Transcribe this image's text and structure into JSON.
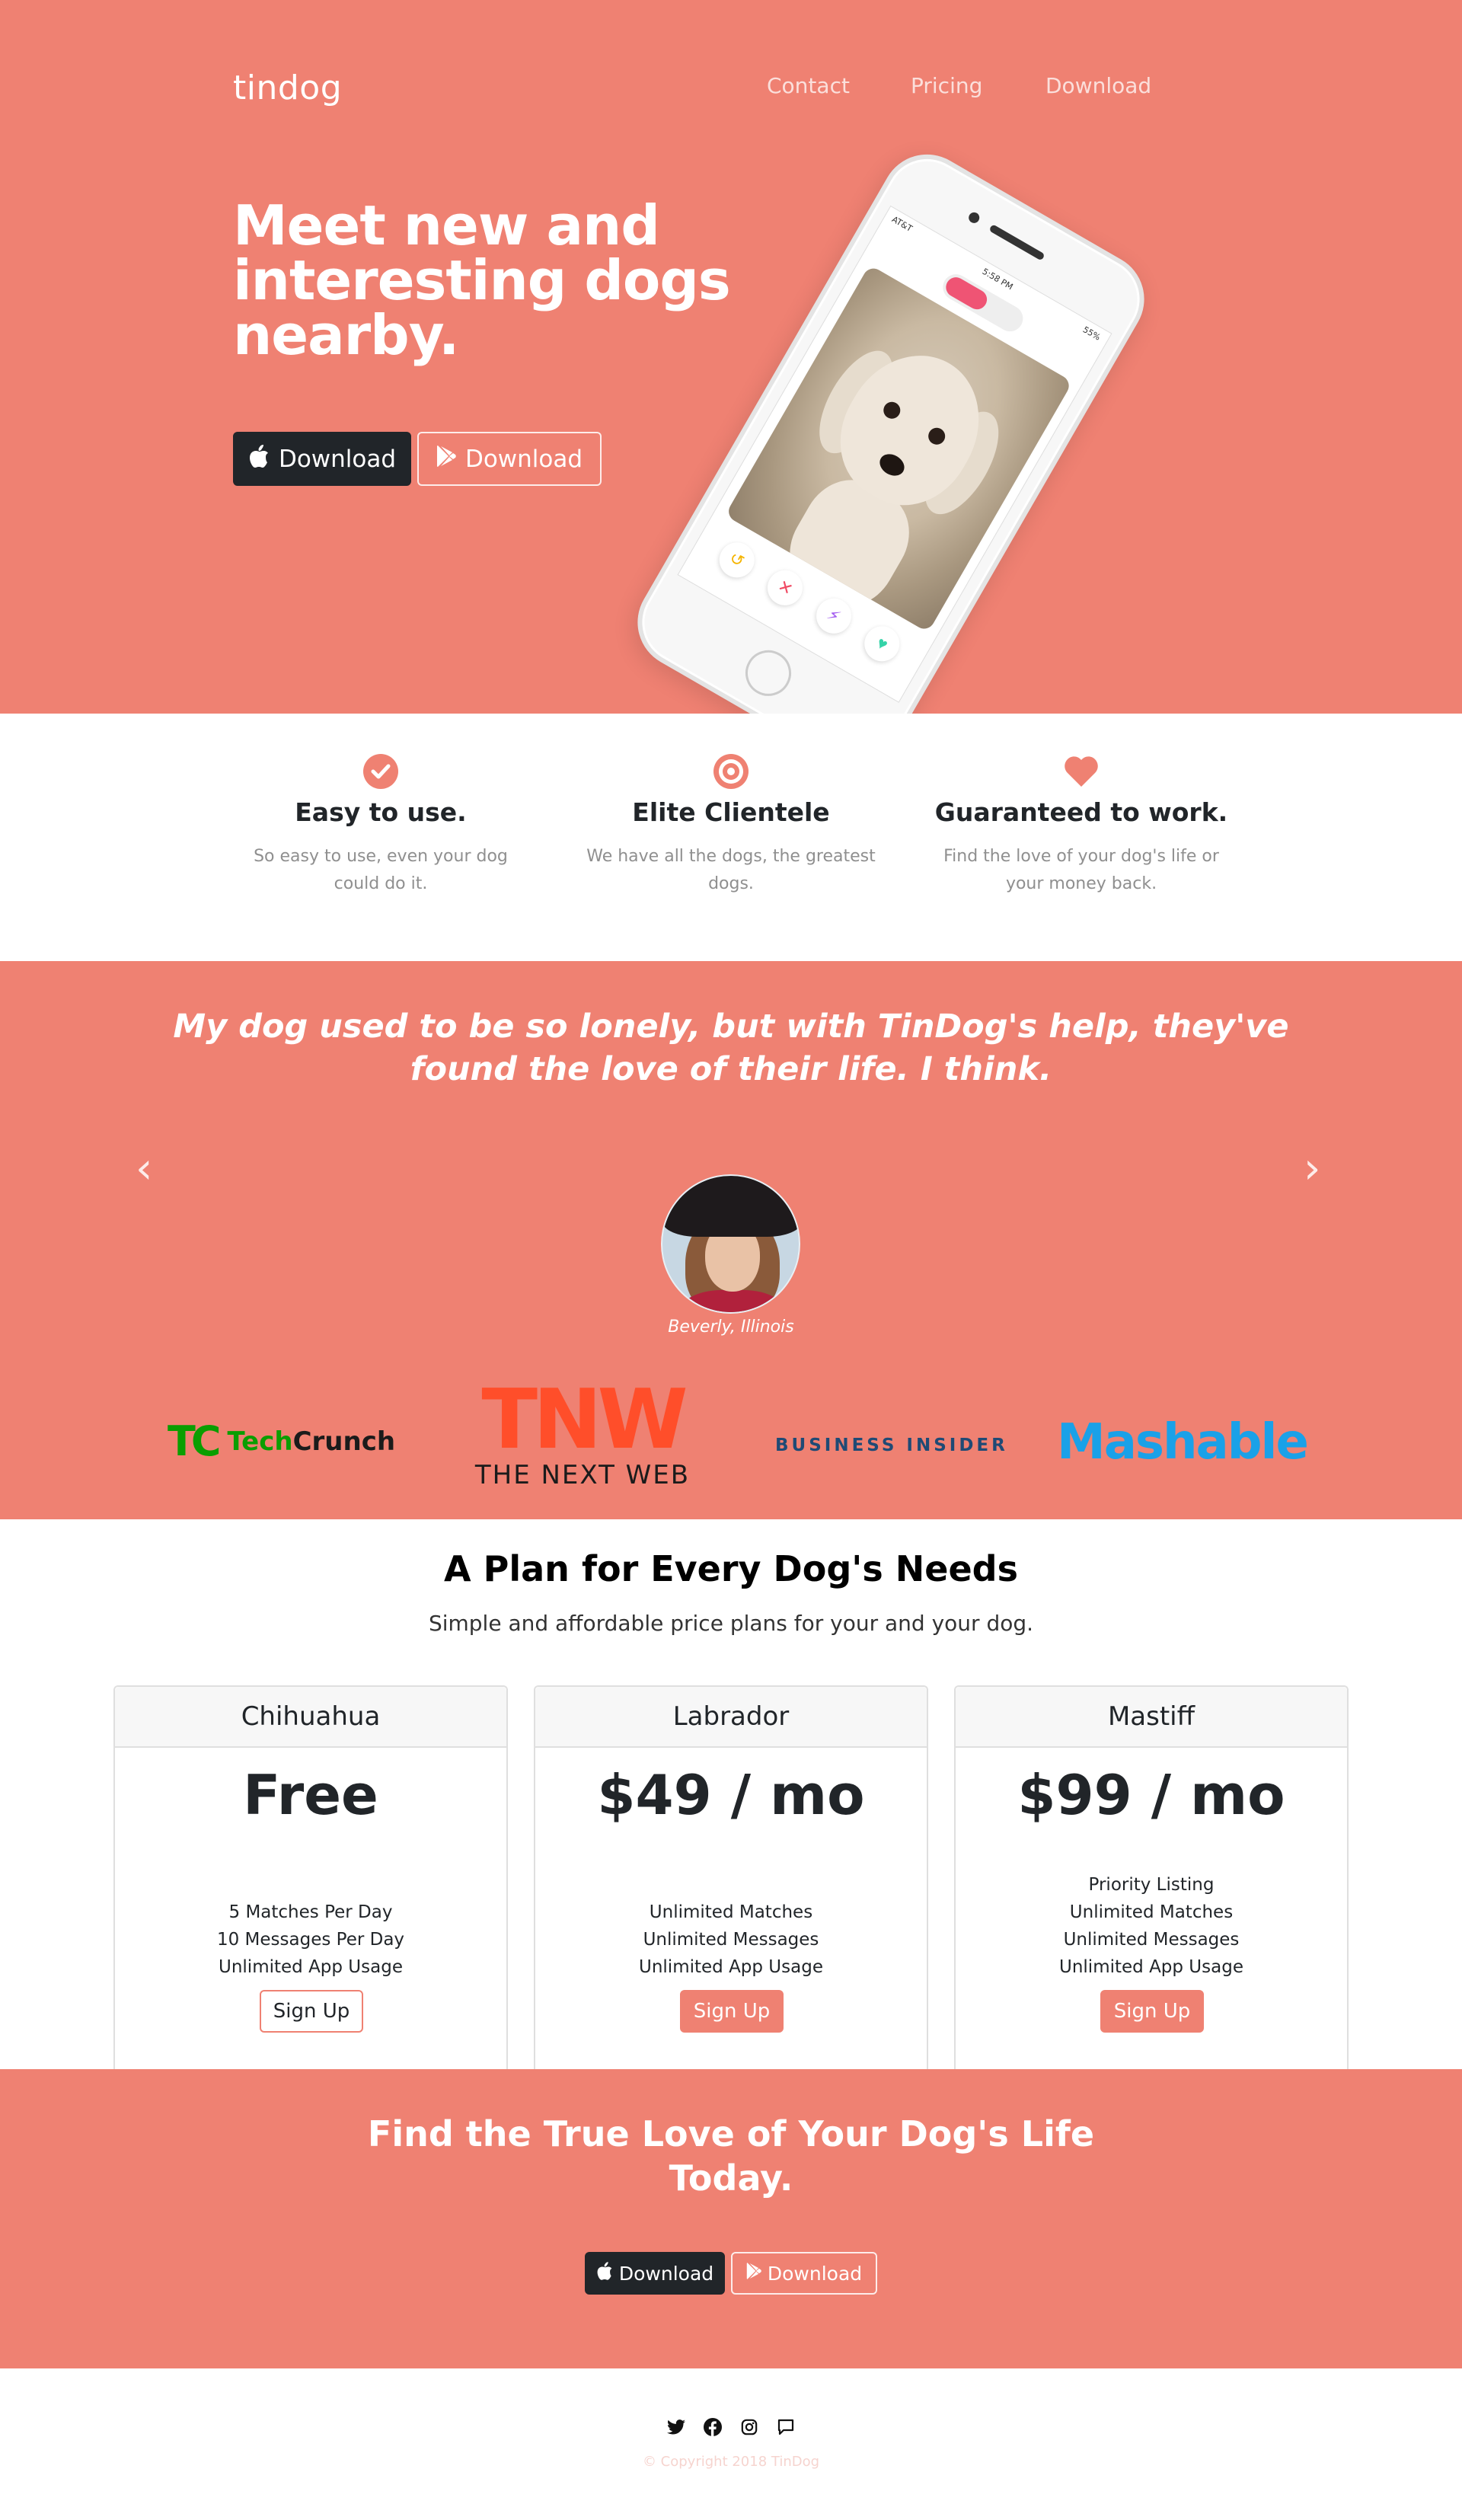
{
  "nav": {
    "brand": "tindog",
    "links": [
      "Contact",
      "Pricing",
      "Download"
    ]
  },
  "hero": {
    "title": "Meet new and interesting dogs nearby.",
    "apple_button": "Download",
    "play_button": "Download",
    "phone": {
      "carrier": "AT&T",
      "time": "5:58 PM",
      "battery": "55%"
    }
  },
  "features": [
    {
      "icon": "check-circle-icon",
      "title": "Easy to use.",
      "text": "So easy to use, even your dog could do it."
    },
    {
      "icon": "bullseye-icon",
      "title": "Elite Clientele",
      "text": "We have all the dogs, the greatest dogs."
    },
    {
      "icon": "heart-icon",
      "title": "Guaranteed to work.",
      "text": "Find the love of your dog's life or your money back."
    }
  ],
  "testimonial": {
    "quote": "My dog used to be so lonely, but with TinDog's help, they've found the love of their life. I think.",
    "caption": "Beverly, Illinois",
    "prev": "‹",
    "next": "›"
  },
  "press": {
    "techcrunch": {
      "mark": "TC",
      "left": "Tech",
      "right": "Crunch"
    },
    "tnw": {
      "mark": "TNW",
      "text": "THE NEXT WEB"
    },
    "business_insider": "BUSINESS INSIDER",
    "mashable": "Mashable"
  },
  "pricing": {
    "title": "A Plan for Every Dog's Needs",
    "subtitle": "Simple and affordable price plans for your and your dog.",
    "plans": [
      {
        "name": "Chihuahua",
        "price": "Free",
        "features": [
          "5 Matches Per Day",
          "10 Messages Per Day",
          "Unlimited App Usage"
        ],
        "button": "Sign Up"
      },
      {
        "name": "Labrador",
        "price": "$49 / mo",
        "features": [
          "Unlimited Matches",
          "Unlimited Messages",
          "Unlimited App Usage"
        ],
        "button": "Sign Up"
      },
      {
        "name": "Mastiff",
        "price": "$99 / mo",
        "features": [
          "Priority Listing",
          "Unlimited Matches",
          "Unlimited Messages",
          "Unlimited App Usage"
        ],
        "button": "Sign Up"
      }
    ]
  },
  "cta": {
    "title": "Find the True Love of Your Dog's Life Today.",
    "apple_button": "Download",
    "play_button": "Download"
  },
  "footer": {
    "social": [
      "twitter-icon",
      "facebook-icon",
      "instagram-icon",
      "message-icon"
    ],
    "copyright": "© Copyright 2018 TinDog"
  },
  "colors": {
    "primary": "#ef8172",
    "dark": "#212529",
    "white": "#ffffff"
  }
}
